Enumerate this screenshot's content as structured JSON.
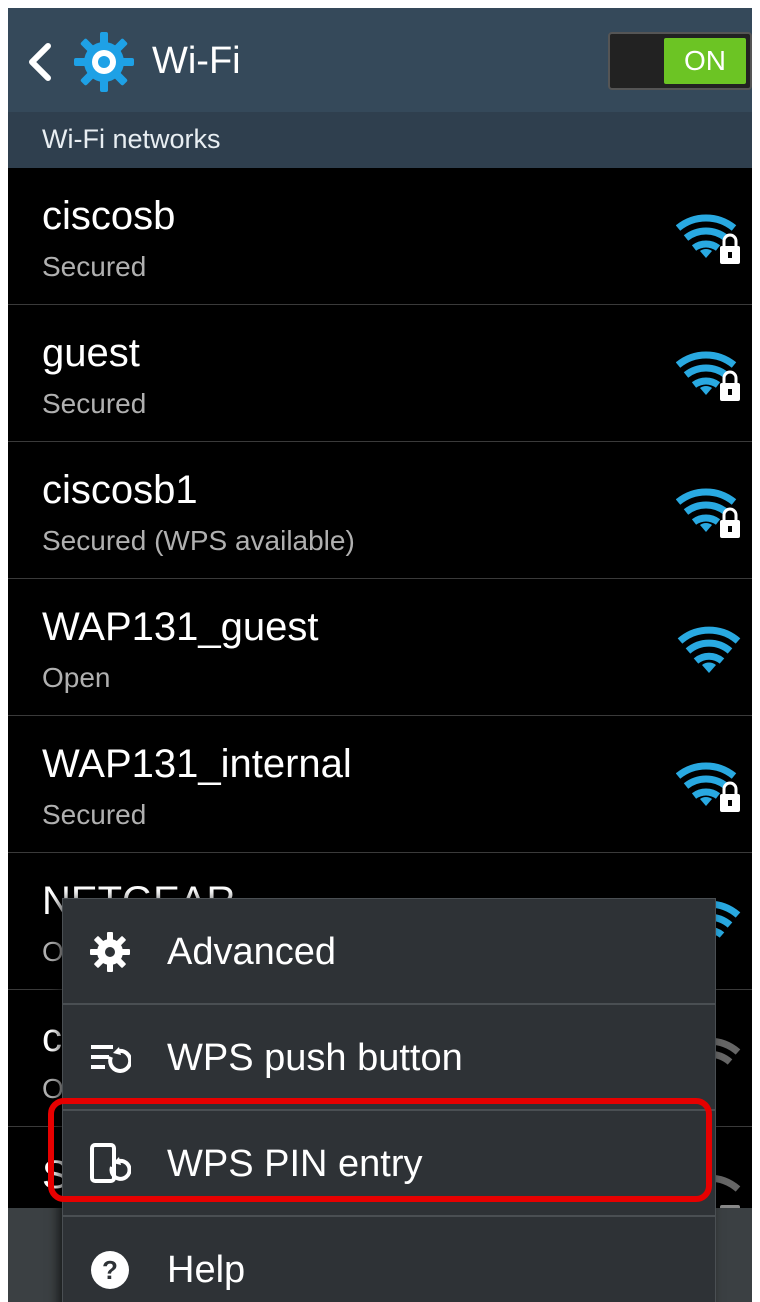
{
  "action_bar": {
    "title": "Wi-Fi",
    "toggle_label": "ON",
    "back_icon": "chevron-left-icon",
    "settings_icon": "gear-icon"
  },
  "section_header": "Wi-Fi networks",
  "networks": [
    {
      "name": "ciscosb",
      "status": "Secured",
      "icon": "wifi-locked-icon"
    },
    {
      "name": "guest",
      "status": "Secured",
      "icon": "wifi-locked-icon"
    },
    {
      "name": "ciscosb1",
      "status": "Secured (WPS available)",
      "icon": "wifi-locked-icon"
    },
    {
      "name": "WAP131_guest",
      "status": "Open",
      "icon": "wifi-icon"
    },
    {
      "name": "WAP131_internal",
      "status": "Secured",
      "icon": "wifi-locked-icon"
    },
    {
      "name": "NETGEAR",
      "status": "O",
      "icon": "wifi-icon"
    },
    {
      "name": "c",
      "status": "O",
      "icon": "wifi-icon"
    },
    {
      "name": "S",
      "status": "",
      "icon": "wifi-locked-icon"
    }
  ],
  "menu": {
    "items": [
      {
        "label": "Advanced",
        "icon": "gear-icon"
      },
      {
        "label": "WPS push button",
        "icon": "wps-push-button-icon"
      },
      {
        "label": "WPS PIN entry",
        "icon": "wps-pin-icon"
      },
      {
        "label": "Help",
        "icon": "help-icon"
      }
    ]
  },
  "colors": {
    "action_bar": "#35495a",
    "toggle_on": "#6cc424",
    "wifi_signal": "#29a9e1",
    "highlight": "#e60000"
  }
}
